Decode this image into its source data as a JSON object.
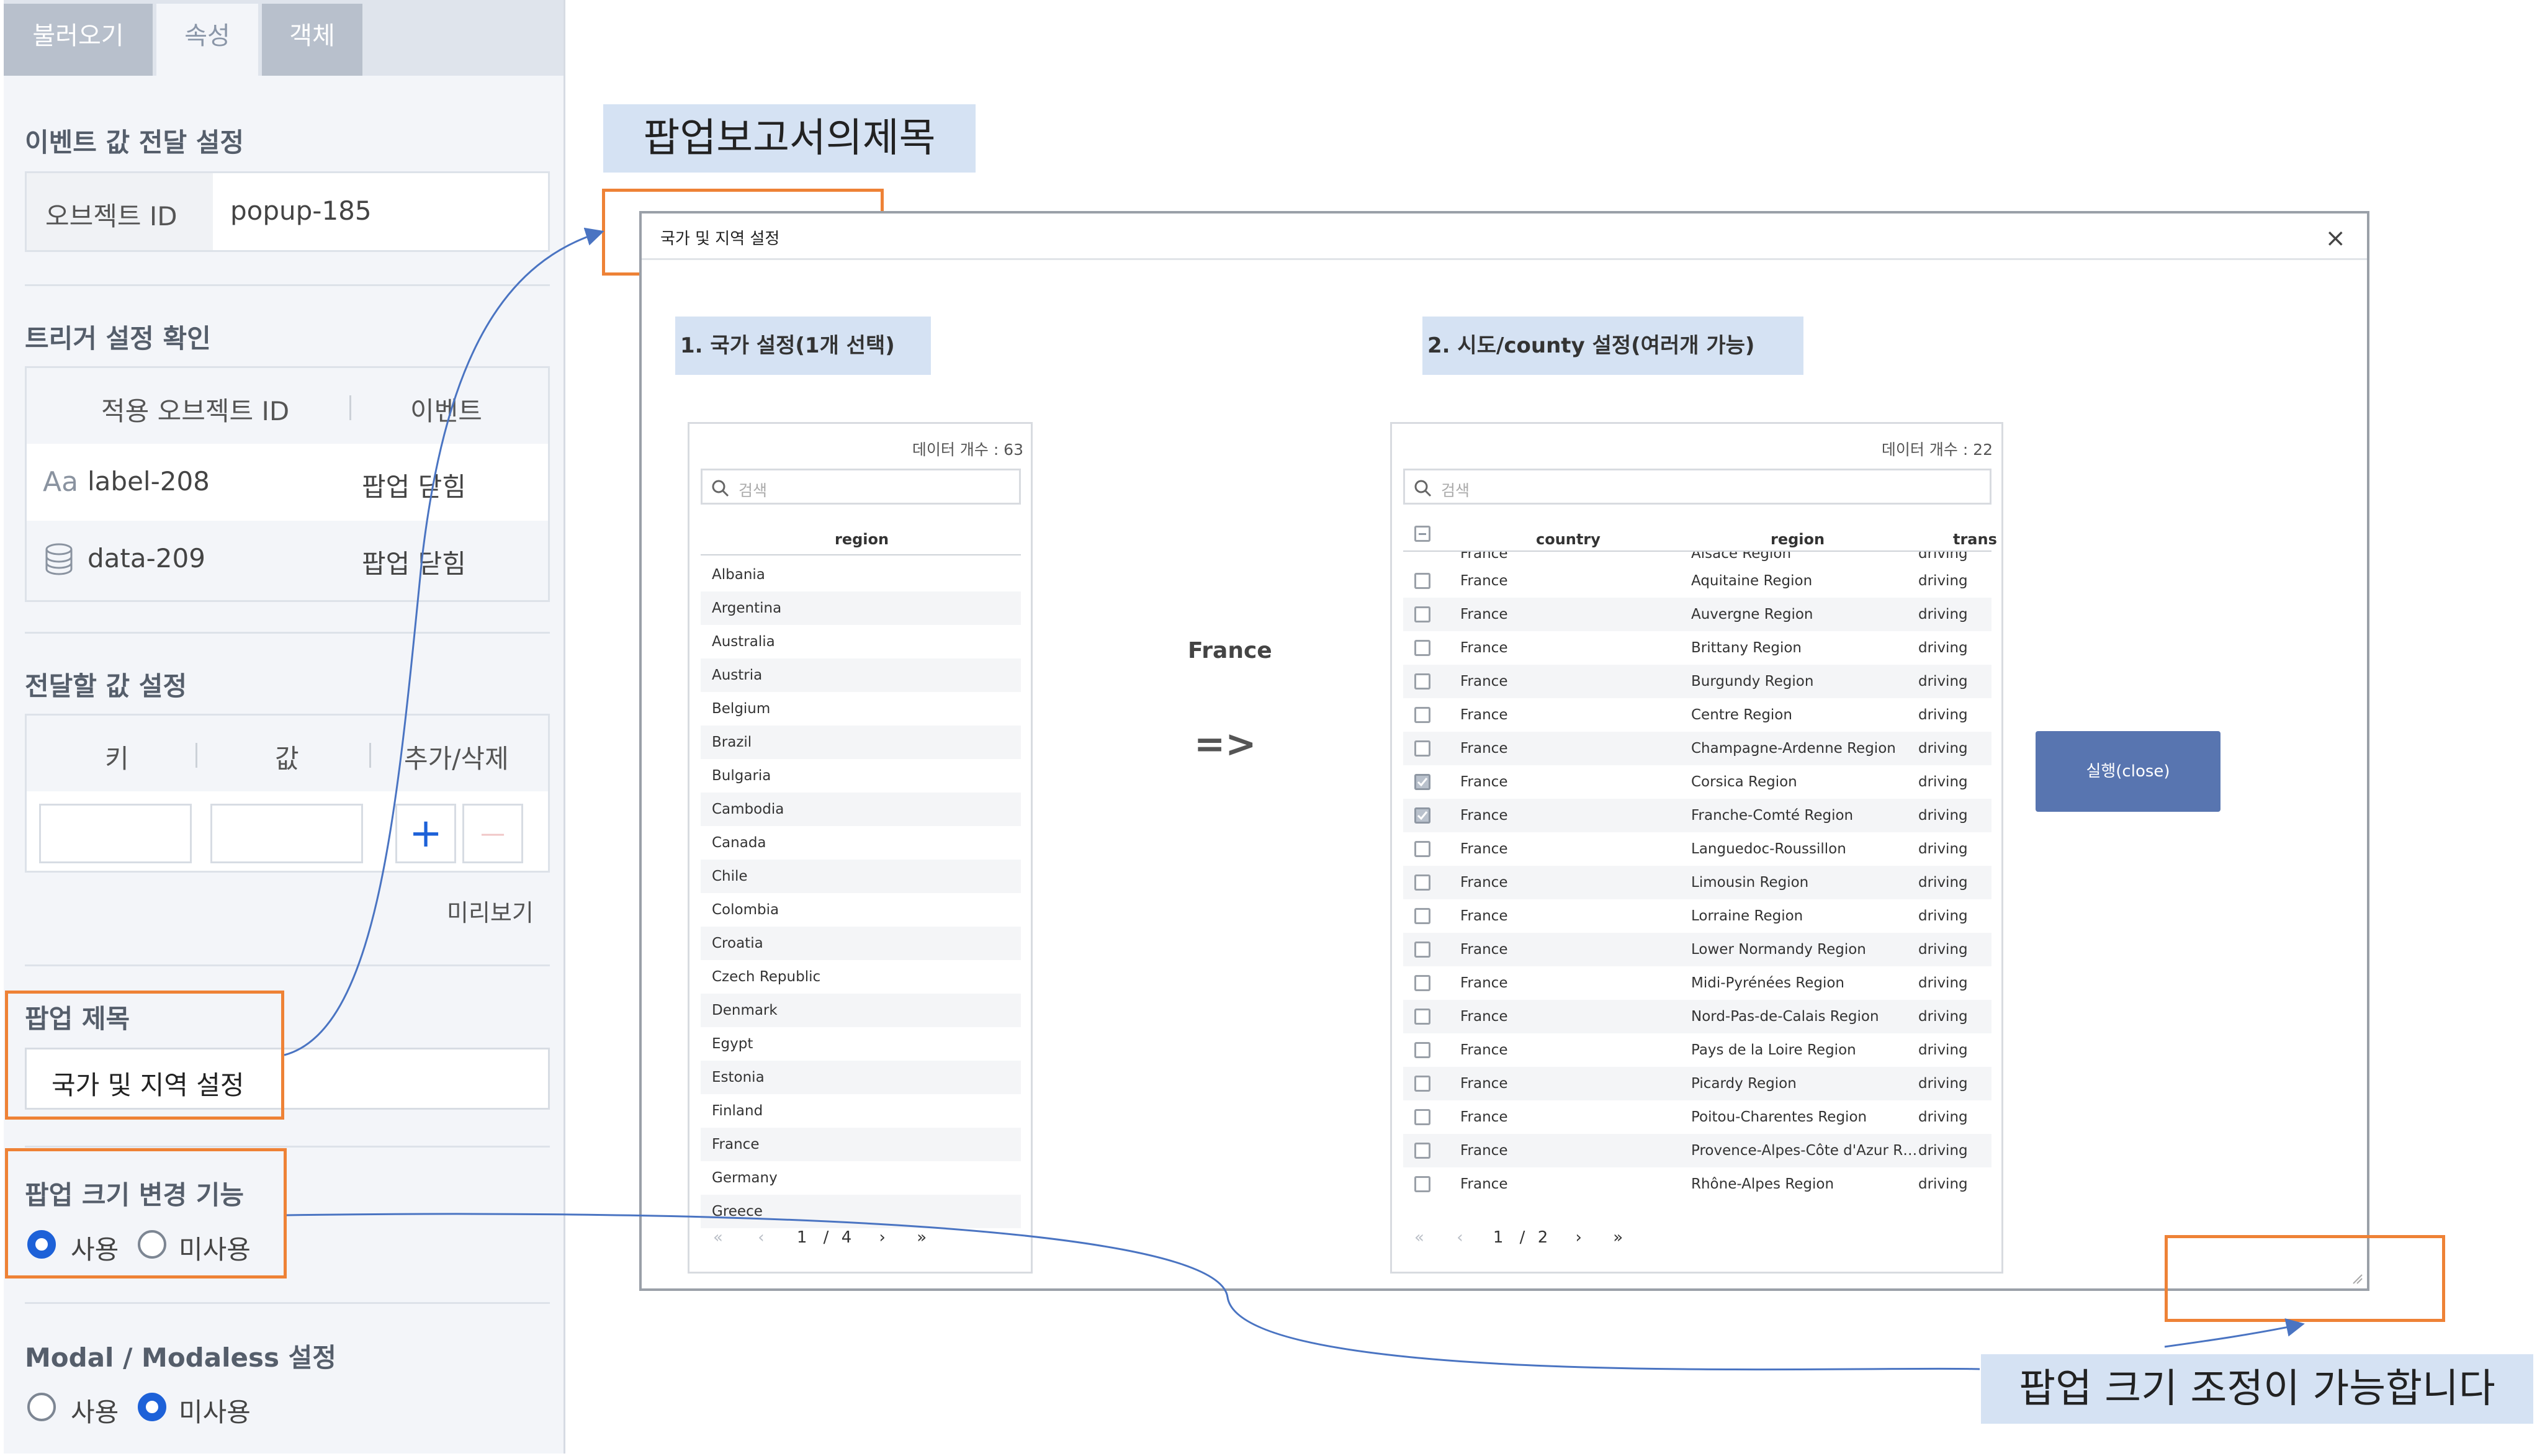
{
  "tabs": [
    "불러오기",
    "속성",
    "객체"
  ],
  "event_section": {
    "title": "이벤트 값 전달 설정",
    "object_id_label": "오브젝트 ID",
    "object_id_value": "popup-185"
  },
  "trigger_section": {
    "title": "트리거 설정 확인",
    "columns": [
      "적용 오브젝트 ID",
      "이벤트"
    ],
    "rows": [
      {
        "icon": "text-label-icon",
        "id": "label-208",
        "event": "팝업 닫힘"
      },
      {
        "icon": "database-icon",
        "id": "data-209",
        "event": "팝업 닫힘"
      }
    ]
  },
  "value_section": {
    "title": "전달할 값 설정",
    "columns": [
      "키",
      "값",
      "추가/삭제"
    ],
    "add_symbol": "+",
    "remove_symbol": "—",
    "preview_label": "미리보기"
  },
  "popup_title_section": {
    "title": "팝업 제목",
    "value": "국가 및 지역 설정"
  },
  "resize_section": {
    "title": "팝업 크기 변경 기능",
    "options": [
      "사용",
      "미사용"
    ],
    "selected": "사용"
  },
  "modal_section": {
    "title": "Modal / Modaless 설정",
    "options": [
      "사용",
      "미사용"
    ],
    "selected": "미사용"
  },
  "callouts": {
    "popup_title_note": "팝업보고서의제목",
    "resize_note": "팝업 크기 조정이 가능합니다"
  },
  "popup": {
    "title": "국가 및 지역 설정",
    "close_symbol": "×",
    "step1_label": "1. 국가 설정(1개 선택)",
    "step2_label": "2. 시도/county 설정(여러개 가능)",
    "selected_country": "France",
    "arrow": "=>",
    "run_button": "실행(close)",
    "left_grid": {
      "count_label": "데이터 개수 : 63",
      "search_placeholder": "검색",
      "column": "region",
      "rows": [
        "Albania",
        "Argentina",
        "Australia",
        "Austria",
        "Belgium",
        "Brazil",
        "Bulgaria",
        "Cambodia",
        "Canada",
        "Chile",
        "Colombia",
        "Croatia",
        "Czech Republic",
        "Denmark",
        "Egypt",
        "Estonia",
        "Finland",
        "France",
        "Germany",
        "Greece"
      ],
      "pager": {
        "first": "«",
        "prev": "‹",
        "current": "1",
        "sep": "/",
        "total": "4",
        "next": "›",
        "last": "»"
      }
    },
    "right_grid": {
      "count_label": "데이터 개수 : 22",
      "search_placeholder": "검색",
      "columns": [
        "country",
        "region",
        "trans"
      ],
      "top_partial": {
        "country": "France",
        "region": "Alsace Region",
        "trans": "driving"
      },
      "rows": [
        {
          "country": "France",
          "region": "Aquitaine Region",
          "trans": "driving",
          "checked": false
        },
        {
          "country": "France",
          "region": "Auvergne Region",
          "trans": "driving",
          "checked": false
        },
        {
          "country": "France",
          "region": "Brittany Region",
          "trans": "driving",
          "checked": false
        },
        {
          "country": "France",
          "region": "Burgundy Region",
          "trans": "driving",
          "checked": false
        },
        {
          "country": "France",
          "region": "Centre Region",
          "trans": "driving",
          "checked": false
        },
        {
          "country": "France",
          "region": "Champagne-Ardenne Region",
          "trans": "driving",
          "checked": false
        },
        {
          "country": "France",
          "region": "Corsica Region",
          "trans": "driving",
          "checked": true
        },
        {
          "country": "France",
          "region": "Franche-Comté Region",
          "trans": "driving",
          "checked": true
        },
        {
          "country": "France",
          "region": "Languedoc-Roussillon",
          "trans": "driving",
          "checked": false
        },
        {
          "country": "France",
          "region": "Limousin Region",
          "trans": "driving",
          "checked": false
        },
        {
          "country": "France",
          "region": "Lorraine Region",
          "trans": "driving",
          "checked": false
        },
        {
          "country": "France",
          "region": "Lower Normandy Region",
          "trans": "driving",
          "checked": false
        },
        {
          "country": "France",
          "region": "Midi-Pyrénées Region",
          "trans": "driving",
          "checked": false
        },
        {
          "country": "France",
          "region": "Nord-Pas-de-Calais Region",
          "trans": "driving",
          "checked": false
        },
        {
          "country": "France",
          "region": "Pays de la Loire Region",
          "trans": "driving",
          "checked": false
        },
        {
          "country": "France",
          "region": "Picardy Region",
          "trans": "driving",
          "checked": false
        },
        {
          "country": "France",
          "region": "Poitou-Charentes Region",
          "trans": "driving",
          "checked": false
        },
        {
          "country": "France",
          "region": "Provence-Alpes-Côte d'Azur R…",
          "trans": "driving",
          "checked": false
        },
        {
          "country": "France",
          "region": "Rhône-Alpes Region",
          "trans": "driving",
          "checked": false
        }
      ],
      "pager": {
        "first": "«",
        "prev": "‹",
        "current": "1",
        "sep": "/",
        "total": "2",
        "next": "›",
        "last": "»"
      }
    }
  },
  "colors": {
    "accent_blue": "#1d61d8",
    "highlight_orange": "#ee8236",
    "callout_bg": "#d5e2f3",
    "run_button_bg": "#5875b0"
  }
}
